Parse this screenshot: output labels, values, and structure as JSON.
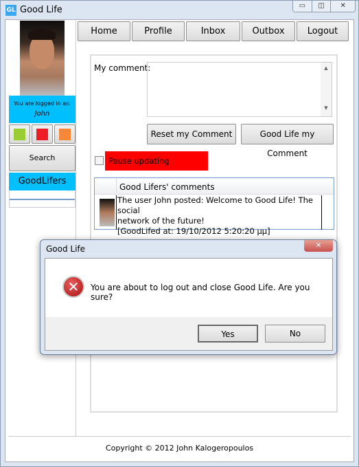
{
  "window": {
    "title": "Good Life",
    "logo": "GL",
    "controls": [
      "minimize-icon",
      "restore-icon",
      "close-icon"
    ]
  },
  "sidebar": {
    "logged_in_label": "You are logged in as:",
    "username": "John",
    "status_colors": [
      "#9acd32",
      "#ee1c24",
      "#f7883a"
    ],
    "search_button": "Search GoodLifers",
    "goodlifers_header": "GoodLifers"
  },
  "nav": [
    "Home",
    "Profile",
    "Inbox",
    "Outbox",
    "Logout"
  ],
  "comment": {
    "label": "My comment:",
    "value": "",
    "reset_button": "Reset my Comment",
    "submit_button": "Good Life my Comment"
  },
  "pause": {
    "label": "Pause updating comments",
    "checked": false
  },
  "comments_grid": {
    "header": "Good Lifers' comments",
    "rows": [
      {
        "line1": "The user John posted: Welcome to Good Life! The social",
        "line2": "network of the future!",
        "line3": "[GoodLifed at: 19/10/2012 5:20:20 μμ]"
      }
    ]
  },
  "footer": "Copyright © 2012 John Kalogeropoulos",
  "dialog": {
    "title": "Good Life",
    "message": "You are about to log out and close Good Life. Are you sure?",
    "yes": "Yes",
    "no": "No",
    "icon": "error-icon"
  }
}
